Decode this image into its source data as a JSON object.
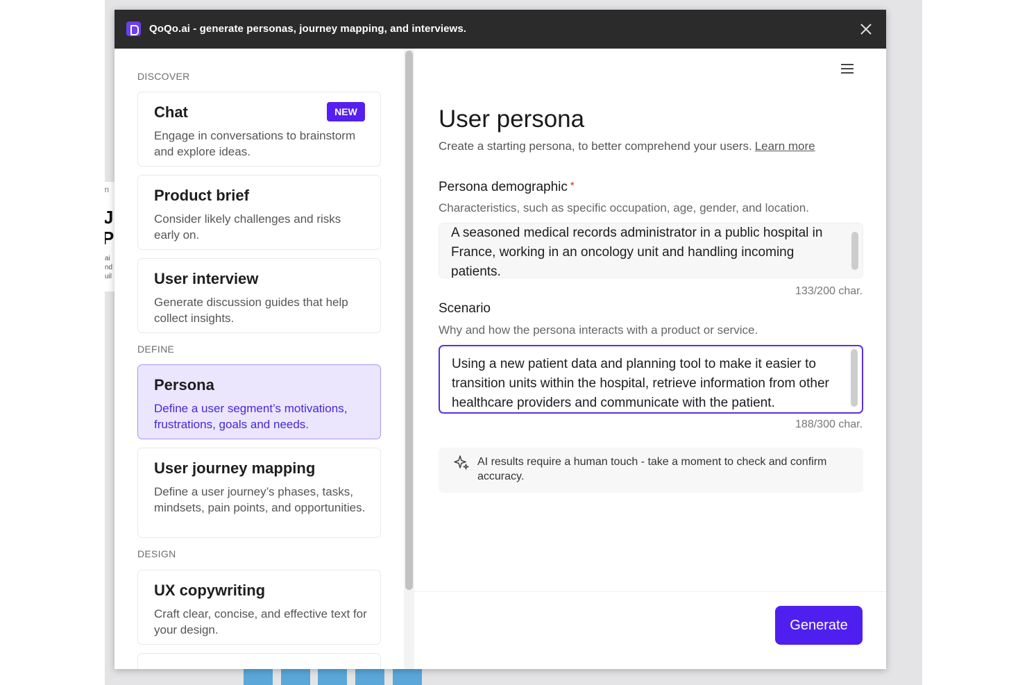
{
  "window": {
    "title": "QoQo.ai - generate personas, journey mapping, and interviews."
  },
  "icons": {
    "logo": "qoqo-logo-icon",
    "close": "close-icon",
    "menu": "hamburger-menu-icon",
    "sparkle": "sparkle-icon"
  },
  "colors": {
    "accent": "#5520ee",
    "active_bg": "#ebe6fd",
    "titlebar": "#2b2b2b",
    "required": "#e0222b"
  },
  "sidebar": {
    "sections": [
      {
        "label": "DISCOVER",
        "items": [
          {
            "title": "Chat",
            "desc": "Engage in conversations to brainstorm and explore ideas.",
            "badge": "NEW"
          },
          {
            "title": "Product brief",
            "desc": "Consider likely challenges and risks early on."
          },
          {
            "title": "User interview",
            "desc": "Generate discussion guides that help collect insights."
          }
        ]
      },
      {
        "label": "DEFINE",
        "items": [
          {
            "title": "Persona",
            "desc": "Define a user segment’s motivations, frustrations, goals and needs.",
            "active": true
          },
          {
            "title": "User journey mapping",
            "desc": "Define a user journey’s phases, tasks, mindsets, pain points, and opportunities."
          }
        ]
      },
      {
        "label": "DESIGN",
        "items": [
          {
            "title": "UX copywriting",
            "desc": "Craft clear, concise, and effective text for your design."
          }
        ]
      }
    ]
  },
  "main": {
    "title": "User persona",
    "subtitle": "Create a starting persona, to better comprehend your users.",
    "learn_more": "Learn more",
    "demographic": {
      "label": "Persona demographic",
      "required_mark": "*",
      "help": "Characteristics, such as specific occupation, age, gender, and location.",
      "value": "A seasoned medical records administrator in a public hospital in France, working in an oncology unit and handling incoming patients.",
      "counter": "133/200 char."
    },
    "scenario": {
      "label": "Scenario",
      "help": "Why and how the persona interacts with a product or service.",
      "value": "Using a new patient data and planning tool to make it easier to transition units within the hospital, retrieve information from other healthcare providers and communicate with the patient.",
      "counter": "188/300 char."
    },
    "notice": "AI results require a human touch - take a moment to check and confirm accuracy.",
    "generate_label": "Generate"
  }
}
